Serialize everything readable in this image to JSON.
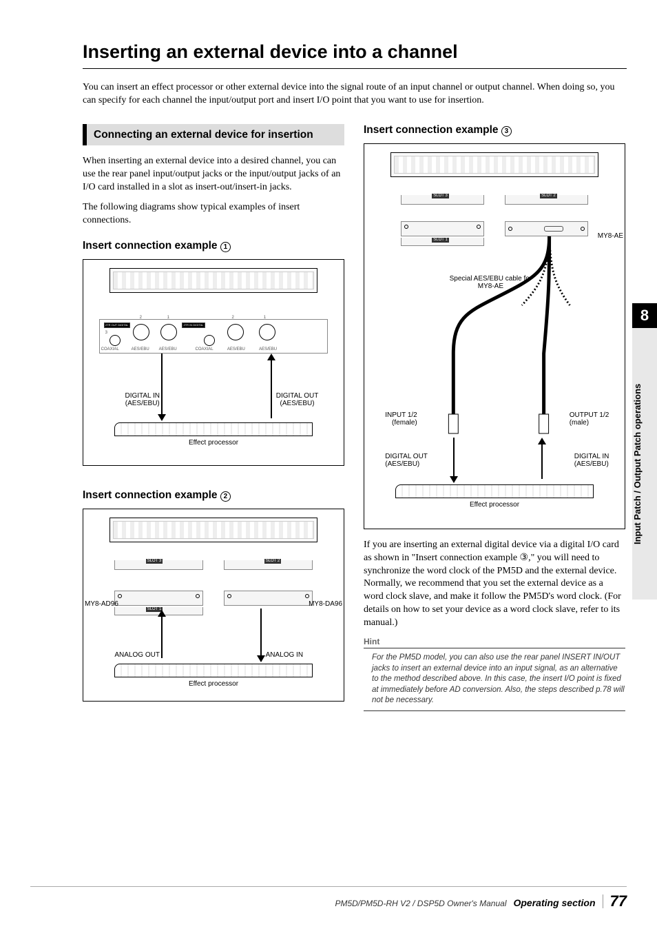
{
  "title": "Inserting an external device into a channel",
  "intro": "You can insert an effect processor or other external device into the signal route of an input channel or output channel. When doing so, you can specify for each channel the input/output port and insert I/O point that you want to use for insertion.",
  "section_head": "Connecting an external device for insertion",
  "left": {
    "p1": "When inserting an external device into a desired channel, you can use the rear panel input/output jacks or the input/output jacks of an I/O card installed in a slot as insert-out/insert-in jacks.",
    "p2": "The following diagrams show typical examples of insert connections.",
    "ex1_title": "Insert connection example",
    "ex1_num": "1",
    "ex2_title": "Insert connection example",
    "ex2_num": "2",
    "d1": {
      "out_block": "2TR OUT DIGITAL",
      "in_block": "2TR IN DIGITAL",
      "coax": "COAXIAL",
      "aes": "AES/EBU",
      "n1": "1",
      "n2": "2",
      "n3": "3",
      "dig_in": "DIGITAL IN",
      "dig_out": "DIGITAL OUT",
      "aesebu": "(AES/EBU)",
      "proc": "Effect processor"
    },
    "d2": {
      "ad": "MY8-AD96",
      "da": "MY8-DA96",
      "analog_out": "ANALOG OUT",
      "analog_in": "ANALOG IN",
      "proc": "Effect processor",
      "slot3": "SLOT 3",
      "slot2": "SLOT 2",
      "slot1": "SLOT 1"
    }
  },
  "right": {
    "ex3_title": "Insert connection example",
    "ex3_num": "3",
    "d3": {
      "ae": "MY8-AE",
      "cable": "Special AES/EBU cable for MY8-AE",
      "in12": "INPUT 1/2",
      "female": "(female)",
      "out12": "OUTPUT 1/2",
      "male": "(male)",
      "dig_out": "DIGITAL OUT",
      "dig_in": "DIGITAL IN",
      "aesebu": "(AES/EBU)",
      "proc": "Effect processor",
      "slot3": "SLOT 3",
      "slot2": "SLOT 2",
      "slot1": "SLOT 1"
    },
    "para": "If you are inserting an external digital device via a digital I/O card as shown in \"Insert connection example ③,\" you will need to synchronize the word clock of the PM5D and the external device. Normally, we recommend that you set the external device as a word clock slave, and make it follow the PM5D's word clock. (For details on how to set your device as a word clock slave, refer to its manual.)",
    "hint_head": "Hint",
    "hint_body": "For the PM5D model, you can also use the rear panel INSERT IN/OUT jacks to insert an external device into an input signal, as an alternative to the method described above. In this case, the insert I/O point is fixed at immediately before AD conversion. Also, the steps described p.78 will not be necessary."
  },
  "tab": {
    "num": "8",
    "text": "Input Patch / Output Patch operations"
  },
  "footer": {
    "doc": "PM5D/PM5D-RH V2 / DSP5D Owner's Manual",
    "sec": "Operating section",
    "page": "77"
  }
}
